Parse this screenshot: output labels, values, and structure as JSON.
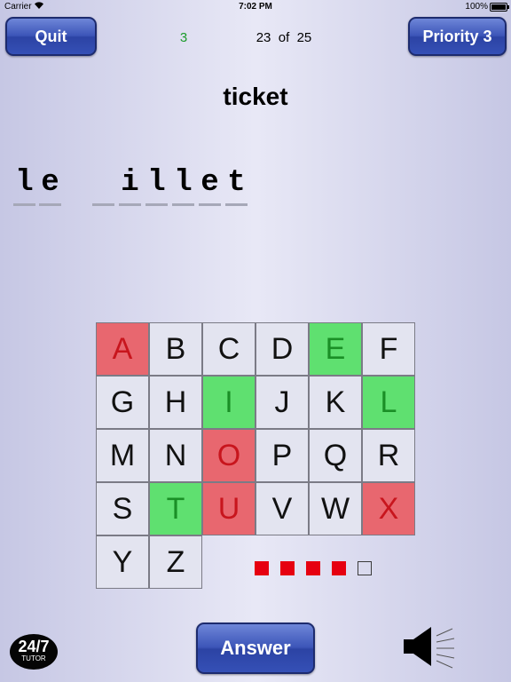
{
  "status_bar": {
    "carrier": "Carrier",
    "time": "7:02 PM",
    "battery": "100%"
  },
  "header": {
    "quit_label": "Quit",
    "score": "3",
    "progress": "23  of  25",
    "priority_label": "Priority 3"
  },
  "word": "ticket",
  "puzzle": [
    "l",
    "e",
    "",
    "",
    "i",
    "l",
    "l",
    "e",
    "t"
  ],
  "grid": [
    {
      "letter": "A",
      "state": "wrong"
    },
    {
      "letter": "B",
      "state": "none"
    },
    {
      "letter": "C",
      "state": "none"
    },
    {
      "letter": "D",
      "state": "none"
    },
    {
      "letter": "E",
      "state": "right"
    },
    {
      "letter": "F",
      "state": "none"
    },
    {
      "letter": "G",
      "state": "none"
    },
    {
      "letter": "H",
      "state": "none"
    },
    {
      "letter": "I",
      "state": "right"
    },
    {
      "letter": "J",
      "state": "none"
    },
    {
      "letter": "K",
      "state": "none"
    },
    {
      "letter": "L",
      "state": "right"
    },
    {
      "letter": "M",
      "state": "none"
    },
    {
      "letter": "N",
      "state": "none"
    },
    {
      "letter": "O",
      "state": "wrong"
    },
    {
      "letter": "P",
      "state": "none"
    },
    {
      "letter": "Q",
      "state": "none"
    },
    {
      "letter": "R",
      "state": "none"
    },
    {
      "letter": "S",
      "state": "none"
    },
    {
      "letter": "T",
      "state": "right"
    },
    {
      "letter": "U",
      "state": "wrong"
    },
    {
      "letter": "V",
      "state": "none"
    },
    {
      "letter": "W",
      "state": "none"
    },
    {
      "letter": "X",
      "state": "wrong"
    },
    {
      "letter": "Y",
      "state": "none"
    },
    {
      "letter": "Z",
      "state": "none"
    }
  ],
  "misses": {
    "used": 4,
    "total": 5
  },
  "answer_label": "Answer",
  "logo": {
    "top": "24/7",
    "bottom": "TUTOR"
  },
  "icons": {
    "speaker": "speaker-icon",
    "wifi": "wifi-icon",
    "battery": "battery-icon"
  },
  "colors": {
    "wrong": "#e8676f",
    "right": "#5fe070",
    "miss": "#e60010",
    "button": "#3c55b8"
  }
}
